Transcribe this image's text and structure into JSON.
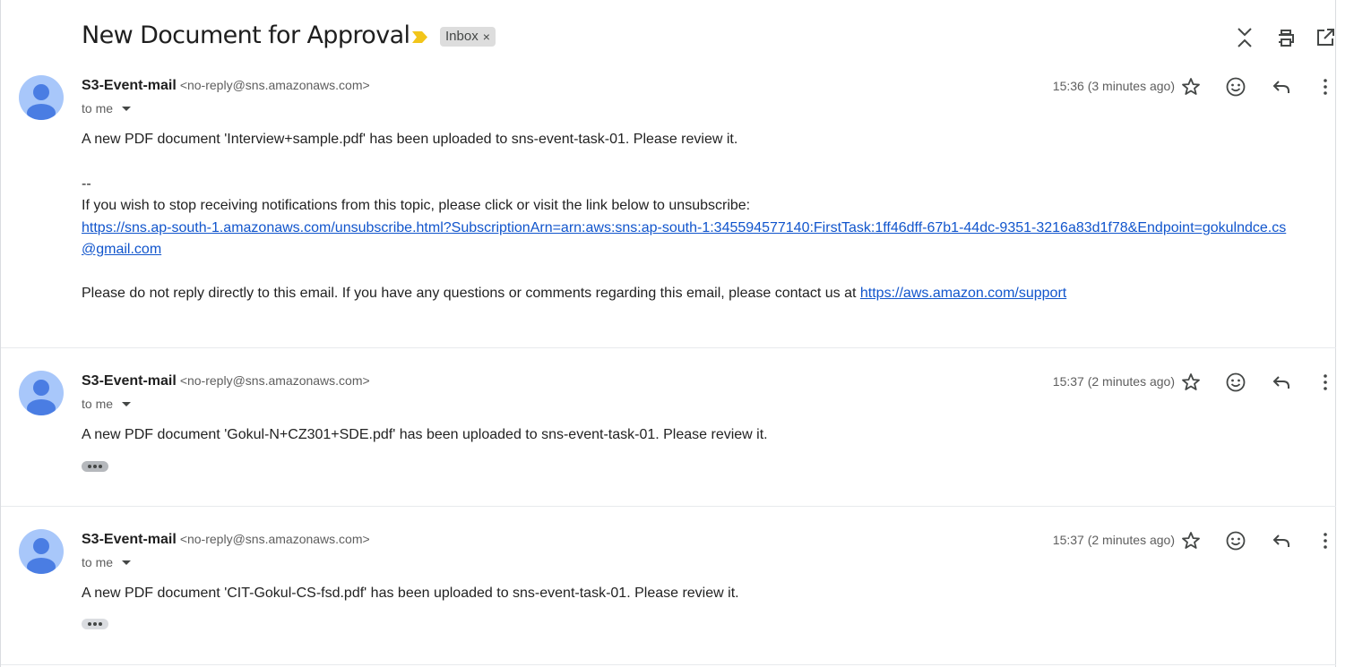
{
  "thread": {
    "subject": "New Document for Approval",
    "label": "Inbox",
    "label_remove": "×"
  },
  "toolbar_icons": [
    "collapse-all-icon",
    "print-icon",
    "open-in-new-window-icon"
  ],
  "messages": [
    {
      "sender_name": "S3-Event-mail",
      "sender_email": "<no-reply@sns.amazonaws.com>",
      "recipient": "to me",
      "time": "15:36 (3 minutes ago)",
      "body_line1": "A new PDF document 'Interview+sample.pdf' has been uploaded to sns-event-task-01. Please review it.",
      "signature_sep": "--",
      "unsubscribe_text": "If you wish to stop receiving notifications from this topic, please click or visit the link below to unsubscribe:",
      "unsubscribe_link": "https://sns.ap-south-1.amazonaws.com/unsubscribe.html?SubscriptionArn=arn:aws:sns:ap-south-1:345594577140:FirstTask:1ff46dff-67b1-44dc-9351-3216a83d1f78&Endpoint=gokulndce.cs@gmail.com",
      "footer_text": "Please do not reply directly to this email. If you have any questions or comments regarding this email, please contact us at ",
      "support_link": "https://aws.amazon.com/support"
    },
    {
      "sender_name": "S3-Event-mail",
      "sender_email": "<no-reply@sns.amazonaws.com>",
      "recipient": "to me",
      "time": "15:37 (2 minutes ago)",
      "body_line1": "A new PDF document 'Gokul-N+CZ301+SDE.pdf' has been uploaded to sns-event-task-01. Please review it."
    },
    {
      "sender_name": "S3-Event-mail",
      "sender_email": "<no-reply@sns.amazonaws.com>",
      "recipient": "to me",
      "time": "15:37 (2 minutes ago)",
      "body_line1": "A new PDF document 'CIT-Gokul-CS-fsd.pdf' has been uploaded to sns-event-task-01. Please review it."
    }
  ],
  "colors": {
    "link": "#1155cc",
    "avatar_bg": "#a8c7fa",
    "avatar_fg": "#4a7de3",
    "importance": "#f2c51a"
  }
}
